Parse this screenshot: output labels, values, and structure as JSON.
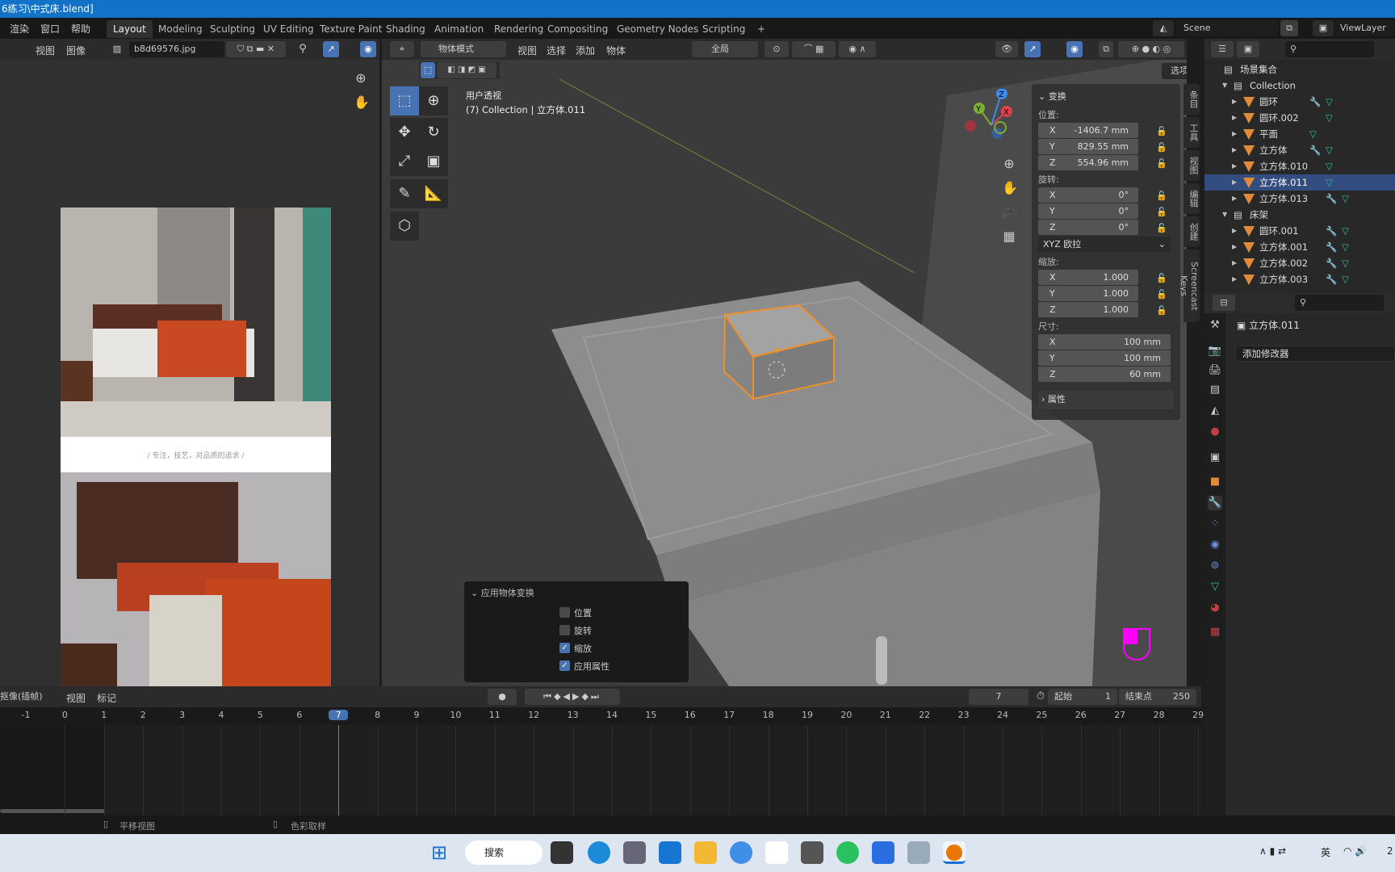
{
  "title": "6练习\\中式床.blend]",
  "menu": [
    "渲染",
    "窗口",
    "帮助"
  ],
  "workspaces": [
    "Layout",
    "Modeling",
    "Sculpting",
    "UV Editing",
    "Texture Paint",
    "Shading",
    "Animation",
    "Rendering",
    "Compositing",
    "Geometry Nodes",
    "Scripting",
    "+"
  ],
  "active_workspace": "Layout",
  "scene": "Scene",
  "view_layer": "ViewLayer",
  "image_editor": {
    "menu": [
      "视图",
      "图像"
    ],
    "image_name": "b8d69576.jpg",
    "caption": "/ 专注，技艺，对品质的追求 /"
  },
  "viewport": {
    "mode": "物体模式",
    "menu": [
      "视图",
      "选择",
      "添加",
      "物体"
    ],
    "orientation": "全局",
    "options": "选项",
    "view_name": "用户透视",
    "view_info": "(7) Collection | 立方体.011",
    "gizmo_axes": [
      "X",
      "Y",
      "Z"
    ]
  },
  "npanel": {
    "section": "变换",
    "location_label": "位置:",
    "location": [
      {
        "axis": "X",
        "value": "-1406.7 mm"
      },
      {
        "axis": "Y",
        "value": "829.55 mm"
      },
      {
        "axis": "Z",
        "value": "554.96 mm"
      }
    ],
    "rotation_label": "旋转:",
    "rotation": [
      {
        "axis": "X",
        "value": "0°"
      },
      {
        "axis": "Y",
        "value": "0°"
      },
      {
        "axis": "Z",
        "value": "0°"
      }
    ],
    "rotation_mode": "XYZ 欧拉",
    "scale_label": "缩放:",
    "scale": [
      {
        "axis": "X",
        "value": "1.000"
      },
      {
        "axis": "Y",
        "value": "1.000"
      },
      {
        "axis": "Z",
        "value": "1.000"
      }
    ],
    "dimensions_label": "尺寸:",
    "dimensions": [
      {
        "axis": "X",
        "value": "100 mm"
      },
      {
        "axis": "Y",
        "value": "100 mm"
      },
      {
        "axis": "Z",
        "value": "60 mm"
      }
    ],
    "properties_section": "属性",
    "tabs": [
      "条目",
      "工具",
      "视图",
      "编辑",
      "创建",
      "Screencast Keys"
    ]
  },
  "apply_popup": {
    "title": "应用物体变换",
    "options": [
      {
        "label": "位置",
        "checked": false
      },
      {
        "label": "旋转",
        "checked": false
      },
      {
        "label": "缩放",
        "checked": true
      },
      {
        "label": "应用属性",
        "checked": true
      }
    ]
  },
  "outliner": {
    "root": "场景集合",
    "rows": [
      {
        "label": "Collection",
        "type": "collection",
        "depth": 0
      },
      {
        "label": "圆环",
        "type": "mesh",
        "depth": 1,
        "modifier": true
      },
      {
        "label": "圆环.002",
        "type": "mesh",
        "depth": 1,
        "modifier": false
      },
      {
        "label": "平面",
        "type": "mesh",
        "depth": 1,
        "modifier": false
      },
      {
        "label": "立方体",
        "type": "mesh",
        "depth": 1,
        "modifier": true
      },
      {
        "label": "立方体.010",
        "type": "mesh",
        "depth": 1,
        "modifier": false
      },
      {
        "label": "立方体.011",
        "type": "mesh",
        "depth": 1,
        "modifier": false,
        "selected": true
      },
      {
        "label": "立方体.013",
        "type": "mesh",
        "depth": 1,
        "modifier": true
      },
      {
        "label": "床架",
        "type": "collection",
        "depth": 0
      },
      {
        "label": "圆环.001",
        "type": "mesh",
        "depth": 1,
        "modifier": true
      },
      {
        "label": "立方体.001",
        "type": "mesh",
        "depth": 1,
        "modifier": true
      },
      {
        "label": "立方体.002",
        "type": "mesh",
        "depth": 1,
        "modifier": true
      },
      {
        "label": "立方体.003",
        "type": "mesh",
        "depth": 1,
        "modifier": true
      }
    ]
  },
  "properties": {
    "object_name": "立方体.011",
    "add_modifier": "添加修改器"
  },
  "timeline": {
    "mode": "抠像(插帧)",
    "menu": [
      "视图",
      "标记"
    ],
    "current_frame": "7",
    "start_label": "起始",
    "start": "1",
    "end_label": "结束点",
    "end": "250",
    "ticks": [
      -1,
      0,
      1,
      2,
      3,
      4,
      5,
      6,
      7,
      8,
      9,
      10,
      11,
      12,
      13,
      14,
      15,
      16,
      17,
      18,
      19,
      20,
      21,
      22,
      23,
      24,
      25,
      26,
      27,
      28,
      29
    ]
  },
  "status": [
    "平移视图",
    "色彩取样"
  ],
  "taskbar": {
    "search": "搜索",
    "ime": "英",
    "time_partial": "2"
  },
  "colors": {
    "accent": "#4772b3",
    "selection": "#e08a3a",
    "titlebar": "#1272c8"
  }
}
